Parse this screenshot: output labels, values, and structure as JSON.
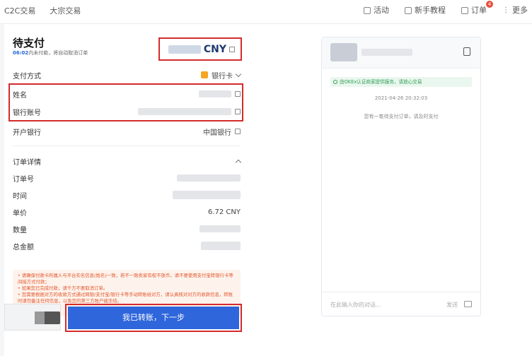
{
  "nav": {
    "c2c": "C2C交易",
    "block": "大宗交易"
  },
  "toolbar": {
    "activity": "活动",
    "tutorial": "新手教程",
    "orders": "订单",
    "orders_badge": "4",
    "more": "更多"
  },
  "order": {
    "title": "待支付",
    "countdown_time": "06:02",
    "countdown_text": "内未付款，将自动取消订单",
    "currency": "CNY"
  },
  "payment": {
    "method_label": "支付方式",
    "method_value": "银行卡",
    "name_label": "姓名",
    "account_label": "银行账号",
    "bank_label": "开户银行",
    "bank_value": "中国银行"
  },
  "details": {
    "section_label": "订单详情",
    "order_no_label": "订单号",
    "time_label": "时间",
    "price_label": "单价",
    "price_value": "6.72 CNY",
    "qty_label": "数量",
    "total_label": "总金额"
  },
  "notice": {
    "line1": "• 请确保付款卡所属人与平台实名信息(姓名)一致，若不一致卖家有权不放币，请不要使用支付宝转银行卡等间接方式付款；",
    "line2": "• 如果您已完成付款，请千万不要取消订单。",
    "line3": "• 您需要根据对方的收款方式通过网银/支付宝/银行卡等手动转账给对方，请认真核对对方的收款信息，转账时请勿备注任何信息，以免您的第三方账户被冻结。"
  },
  "actions": {
    "confirm": "我已转账，下一步"
  },
  "chat": {
    "safety_note": "由OKEx认证商家提供服务，请放心交易",
    "timestamp": "2021-04-26 20:32:03",
    "system_msg": "您有一笔待支付订单，请及时支付",
    "input_placeholder": "在此输入你的对话...",
    "send": "发送"
  }
}
